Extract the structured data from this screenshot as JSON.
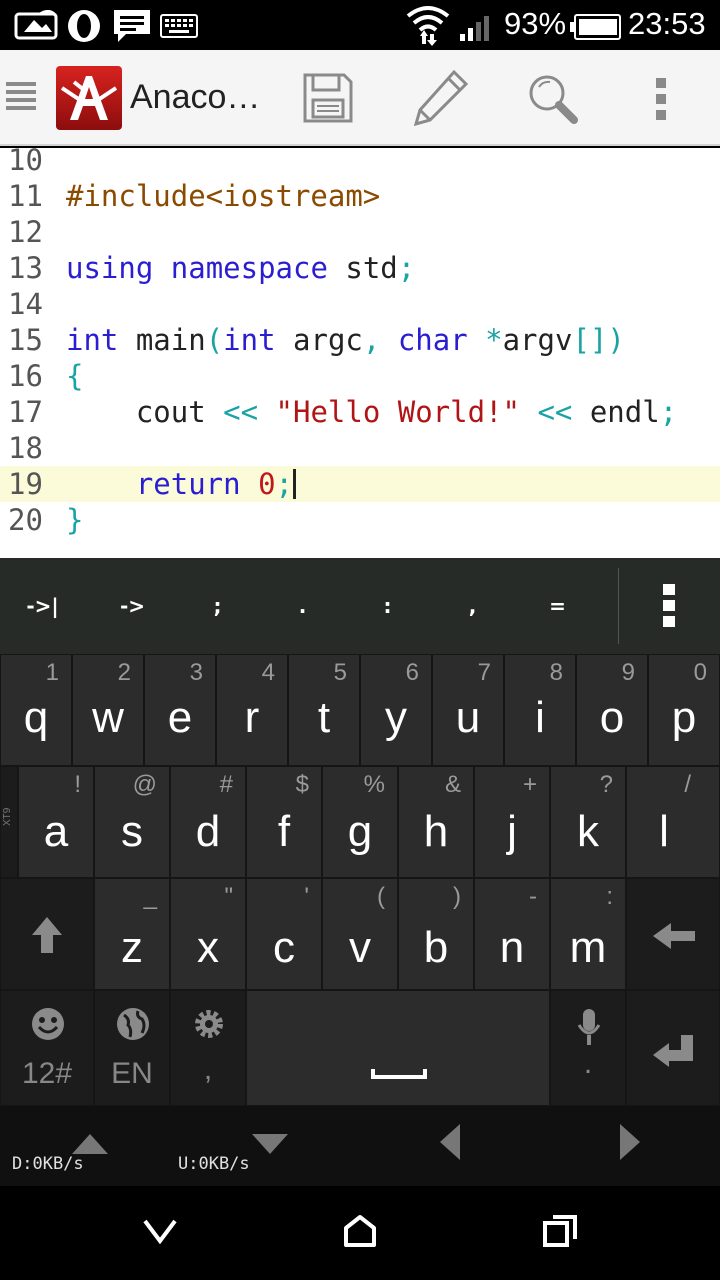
{
  "status_bar": {
    "battery": "93%",
    "time": "23:53",
    "icons": [
      "photo-notification-icon",
      "opera-icon",
      "message-icon",
      "keyboard-icon",
      "wifi-icon",
      "signal-icon",
      "battery-icon"
    ]
  },
  "action_bar": {
    "app_title": "Anaco…",
    "icons": [
      "menu-icon",
      "app-logo",
      "save-icon",
      "edit-icon",
      "search-icon",
      "overflow-icon"
    ]
  },
  "editor": {
    "lines": [
      {
        "no": "10"
      },
      {
        "no": "11",
        "text": "#include<iostream>"
      },
      {
        "no": "12"
      },
      {
        "no": "13",
        "k1": "using",
        "k2": "namespace",
        "t1": " std",
        "p1": ";"
      },
      {
        "no": "14"
      },
      {
        "no": "15",
        "k1": "int",
        "t1": " main",
        "p1": "(",
        "k2": "int",
        "t2": " argc",
        "p2": ",",
        "k3": "char",
        "p3": "*",
        "t3": "argv",
        "p4": "[])"
      },
      {
        "no": "16",
        "p1": "{"
      },
      {
        "no": "17",
        "t1": "cout",
        "p1": "<<",
        "s1": "\"Hello World!\"",
        "p2": "<<",
        "t2": "endl",
        "p3": ";"
      },
      {
        "no": "18"
      },
      {
        "no": "19",
        "k1": "return",
        "n1": "0",
        "p1": ";"
      },
      {
        "no": "20",
        "p1": "}"
      }
    ],
    "current_line": "19",
    "colors": {
      "keyword": "#2b1ed1",
      "preprocessor": "#8a4a00",
      "punctuation": "#1aa3a3",
      "string": "#b01414",
      "highlight": "#fbfbd9"
    }
  },
  "symbol_bar": {
    "symbols": [
      "->|",
      "->",
      ";",
      ".",
      ":",
      ",",
      "="
    ],
    "menu_icon": "overflow-icon"
  },
  "keyboard": {
    "row1": [
      {
        "k": "q",
        "h": "1"
      },
      {
        "k": "w",
        "h": "2"
      },
      {
        "k": "e",
        "h": "3"
      },
      {
        "k": "r",
        "h": "4"
      },
      {
        "k": "t",
        "h": "5"
      },
      {
        "k": "y",
        "h": "6"
      },
      {
        "k": "u",
        "h": "7"
      },
      {
        "k": "i",
        "h": "8"
      },
      {
        "k": "o",
        "h": "9"
      },
      {
        "k": "p",
        "h": "0"
      }
    ],
    "row2": [
      {
        "k": "a",
        "h": "!"
      },
      {
        "k": "s",
        "h": "@"
      },
      {
        "k": "d",
        "h": "#"
      },
      {
        "k": "f",
        "h": "$"
      },
      {
        "k": "g",
        "h": "%"
      },
      {
        "k": "h",
        "h": "&"
      },
      {
        "k": "j",
        "h": "+"
      },
      {
        "k": "k",
        "h": "?"
      },
      {
        "k": "l",
        "h": "/"
      }
    ],
    "row3": [
      {
        "k": "z",
        "h": "_"
      },
      {
        "k": "x",
        "h": "\""
      },
      {
        "k": "c",
        "h": "'"
      },
      {
        "k": "v",
        "h": "("
      },
      {
        "k": "b",
        "h": ")"
      },
      {
        "k": "n",
        "h": "-"
      },
      {
        "k": "m",
        "h": ":"
      }
    ],
    "row4": {
      "symbols_label": "12#",
      "language_label": "EN",
      "settings_sub": ",",
      "mic_sub": "."
    },
    "side_label": "XT9",
    "icons": [
      "shift-icon",
      "backspace-icon",
      "emoji-icon",
      "globe-icon",
      "gear-icon",
      "space-icon",
      "mic-icon",
      "enter-icon"
    ]
  },
  "aux_bar": {
    "download": "D:0KB/s",
    "upload": "U:0KB/s",
    "icons": [
      "arrow-up-icon",
      "arrow-down-icon",
      "arrow-left-icon",
      "arrow-right-icon"
    ]
  },
  "nav_bar": {
    "icons": [
      "back-icon",
      "home-icon",
      "recents-icon"
    ]
  }
}
